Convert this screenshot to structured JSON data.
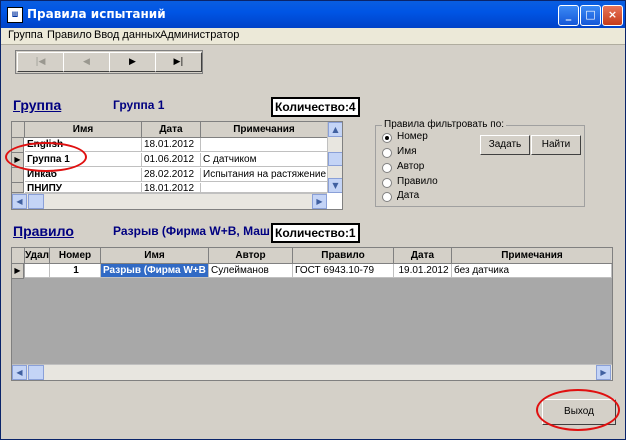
{
  "window": {
    "title": "Правила испытаний",
    "app_icon": "ш"
  },
  "menu": [
    "Группа",
    "Правило",
    "Ввод данных",
    "Администратор"
  ],
  "navigator": {
    "first": "|◀",
    "prior": "◀",
    "next": "▶",
    "last": "▶|"
  },
  "group": {
    "heading": "Группа",
    "current": "Группа 1",
    "count_text": "Количество:4",
    "columns": [
      "Имя",
      "Дата",
      "Примечания"
    ],
    "rows": [
      {
        "name": "English",
        "date": "18.01.2012",
        "note": ""
      },
      {
        "name": "Группа 1",
        "date": "01.06.2012",
        "note": "С датчиком"
      },
      {
        "name": "Инкаб",
        "date": "28.02.2012",
        "note": "Испытания на растяжение"
      },
      {
        "name": "ПНИПУ",
        "date": "18.01.2012",
        "note": ""
      }
    ],
    "selected_row": 1
  },
  "filter": {
    "title": "Правила фильтровать по:",
    "options": [
      "Номер",
      "Имя",
      "Автор",
      "Правило",
      "Дата"
    ],
    "selected": 0,
    "set_button": "Задать",
    "find_button": "Найти"
  },
  "rule": {
    "heading": "Правило",
    "current": "Разрыв (Фирма W+B, Маш",
    "count_text": "Количество:1",
    "columns": [
      "Удал",
      "Номер",
      "Имя",
      "Автор",
      "Правило",
      "Дата",
      "Примечания"
    ],
    "rows": [
      {
        "del": "",
        "num": "1",
        "name": "Разрыв (Фирма W+B",
        "author": "Сулейманов",
        "rule": "ГОСТ 6943.10-79",
        "date": "19.01.2012",
        "note": "без датчика"
      }
    ]
  },
  "exit_button": "Выход",
  "colors": {
    "title_bar": "#0055e5",
    "accent_text": "#000080",
    "annotation": "#e01010",
    "selection": "#316ac5"
  }
}
